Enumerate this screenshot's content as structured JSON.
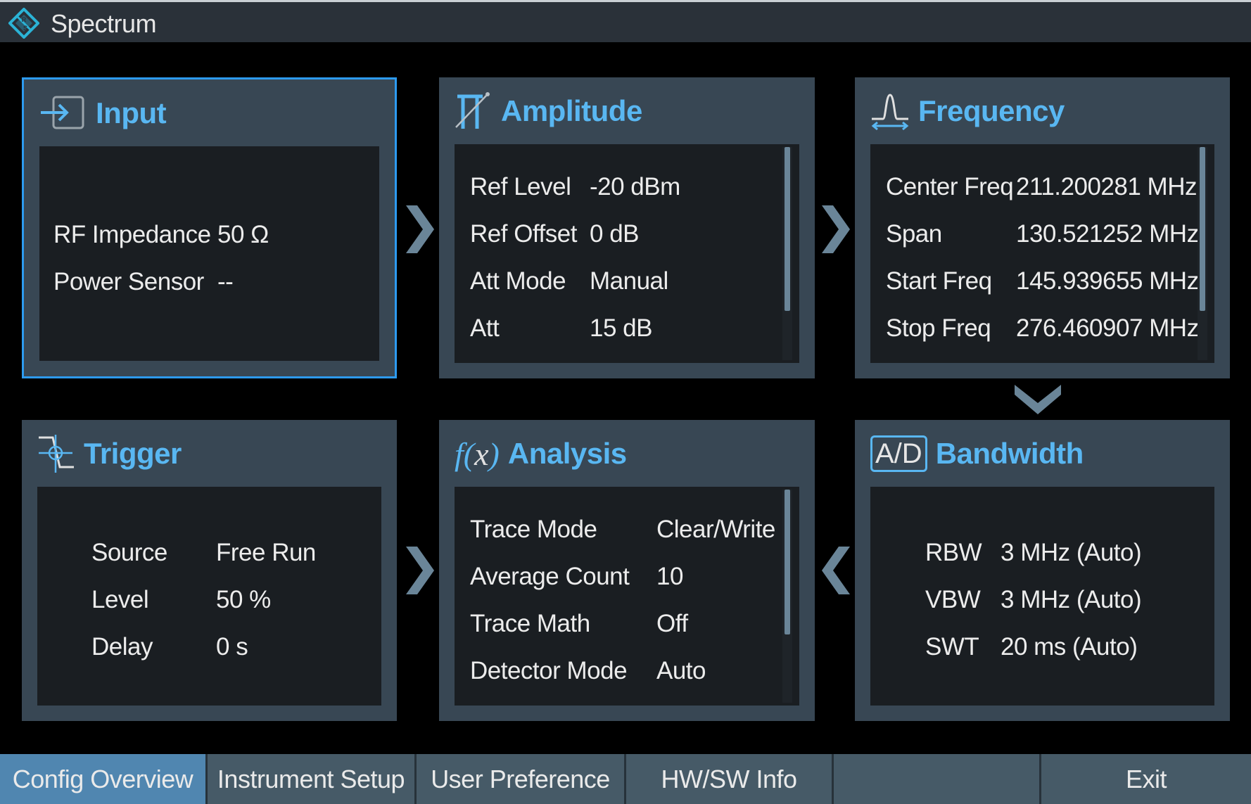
{
  "app": {
    "title": "Spectrum",
    "logo_icon": "rohde-schwarz-logo"
  },
  "colors": {
    "accent": "#59b7f2",
    "selected_border": "#2d9bf0",
    "panel_bg": "#384754",
    "body_bg": "#1a1e22",
    "active_tab": "#5086b0",
    "tab_bg": "#465a67",
    "arrow": "#6a8598"
  },
  "panels": {
    "input": {
      "title": "Input",
      "icon": "input-arrow-icon",
      "selected": true,
      "rows": [
        {
          "label": "RF Impedance",
          "value": "50 Ω"
        },
        {
          "label": "Power Sensor",
          "value": "--"
        }
      ]
    },
    "amplitude": {
      "title": "Amplitude",
      "icon": "amplitude-icon",
      "rows": [
        {
          "label": "Ref Level",
          "value": "-20 dBm"
        },
        {
          "label": "Ref Offset",
          "value": "0 dB"
        },
        {
          "label": "Att Mode",
          "value": "Manual"
        },
        {
          "label": "Att",
          "value": "15 dB"
        }
      ]
    },
    "frequency": {
      "title": "Frequency",
      "icon": "frequency-peak-icon",
      "rows": [
        {
          "label": "Center Freq",
          "value": "211.200281 MHz"
        },
        {
          "label": "Span",
          "value": "130.521252 MHz"
        },
        {
          "label": "Start Freq",
          "value": "145.939655 MHz"
        },
        {
          "label": "Stop Freq",
          "value": "276.460907 MHz"
        }
      ]
    },
    "trigger": {
      "title": "Trigger",
      "icon": "trigger-icon",
      "rows": [
        {
          "label": "Source",
          "value": "Free Run"
        },
        {
          "label": "Level",
          "value": "50 %"
        },
        {
          "label": "Delay",
          "value": "0 s"
        }
      ]
    },
    "analysis": {
      "title": "Analysis",
      "icon": "function-fx-icon",
      "icon_text": "f(x)",
      "rows": [
        {
          "label": "Trace Mode",
          "value": "Clear/Write"
        },
        {
          "label": "Average Count",
          "value": "10"
        },
        {
          "label": "Trace Math",
          "value": "Off"
        },
        {
          "label": "Detector Mode",
          "value": "Auto"
        }
      ]
    },
    "bandwidth": {
      "title": "Bandwidth",
      "icon": "ad-converter-icon",
      "icon_text": "A/D",
      "rows": [
        {
          "label": "RBW",
          "value": "3 MHz (Auto)"
        },
        {
          "label": "VBW",
          "value": "3 MHz (Auto)"
        },
        {
          "label": "SWT",
          "value": "20 ms (Auto)"
        }
      ]
    }
  },
  "tabs": [
    {
      "label": "Config Overview",
      "active": true
    },
    {
      "label": "Instrument Setup"
    },
    {
      "label": "User Preference"
    },
    {
      "label": "HW/SW Info"
    },
    {
      "label": ""
    },
    {
      "label": "Exit"
    }
  ]
}
